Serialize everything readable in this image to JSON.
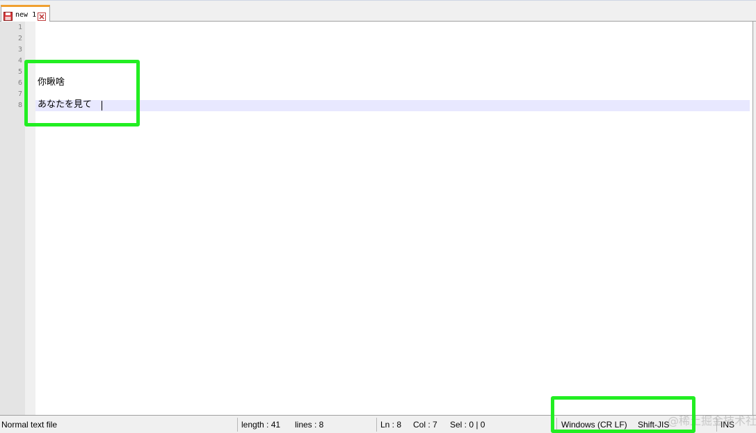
{
  "tabs": [
    {
      "label": "new 1",
      "icon": "save-disk-icon",
      "active": true
    }
  ],
  "editor": {
    "line_numbers": [
      "1",
      "2",
      "3",
      "4",
      "5",
      "6",
      "7",
      "8"
    ],
    "lines": [
      "",
      "",
      "",
      "",
      "",
      "你瞅啥",
      "",
      "あなたを見て"
    ],
    "current_line": 8
  },
  "status": {
    "file_type": "Normal text file",
    "length": "length : 41",
    "lines": "lines : 8",
    "ln": "Ln : 8",
    "col": "Col : 7",
    "sel": "Sel : 0 | 0",
    "eol": "Windows (CR LF)",
    "encoding": "Shift-JIS",
    "mode": "INS"
  },
  "watermark": "@稀土掘金技术社区",
  "colors": {
    "highlight": "#22ee22",
    "current_line_bg": "#e8e8ff",
    "tab_accent": "#f0a030"
  }
}
